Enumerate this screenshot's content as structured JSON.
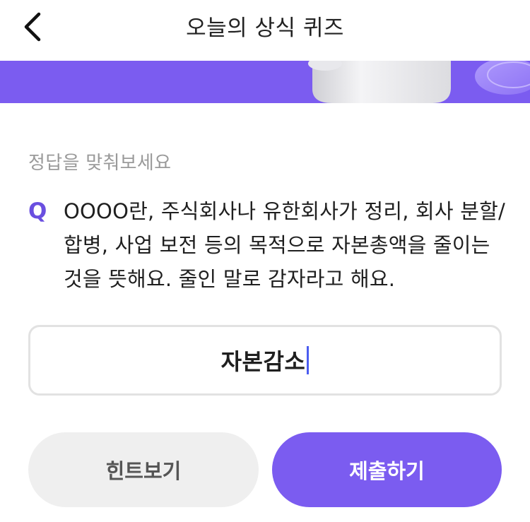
{
  "header": {
    "title": "오늘의 상식 퀴즈",
    "back_icon": "chevron-left-icon"
  },
  "banner": {
    "background_color": "#7b5cf0"
  },
  "quiz": {
    "instruction": "정답을 맞춰보세요",
    "q_marker": "Q",
    "question_text": "OOOO란, 주식회사나 유한회사가 정리, 회사 분할/합병, 사업 보전 등의 목적으로 자본총액을 줄이는 것을 뜻해요. 줄인 말로 감자라고 해요."
  },
  "answer": {
    "value": "자본감소"
  },
  "buttons": {
    "hint_label": "힌트보기",
    "submit_label": "제출하기"
  },
  "colors": {
    "accent": "#7b5cf0",
    "q_marker": "#6a4fe0",
    "caret": "#4b5df0"
  }
}
